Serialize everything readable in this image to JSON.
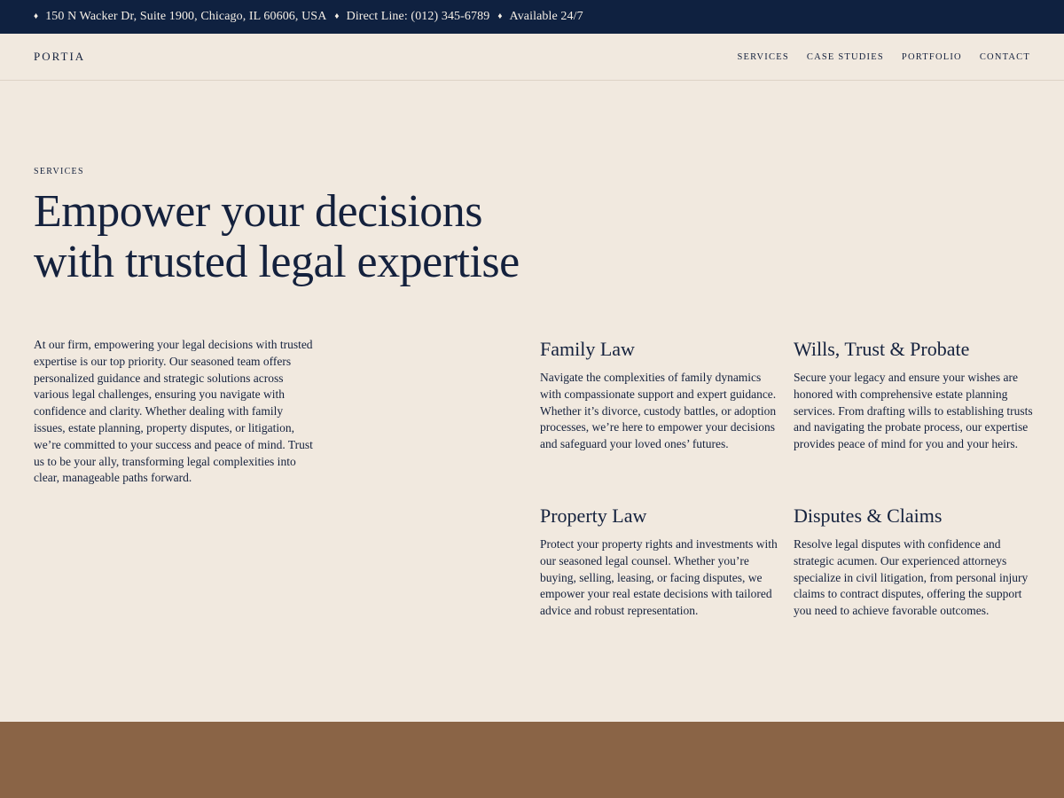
{
  "topbar": {
    "address": "150 N Wacker Dr, Suite 1900, Chicago, IL 60606, USA",
    "phone": "Direct Line: (012) 345-6789",
    "availability": "Available 24/7",
    "separator_icon": "diamond-icon"
  },
  "header": {
    "logo": "PORTIA",
    "nav": [
      "SERVICES",
      "CASE STUDIES",
      "PORTFOLIO",
      "CONTACT"
    ]
  },
  "hero": {
    "eyebrow": "SERVICES",
    "title_line1": "Empower your decisions",
    "title_line2": "with trusted legal expertise"
  },
  "intro": "At our firm, empowering your legal decisions with trusted expertise is our top priority. Our seasoned team offers personalized guidance and strategic solutions across various legal challenges, ensuring you navigate with confidence and clarity. Whether dealing with family issues, estate planning, property disputes, or litigation, we’re committed to your success and peace of mind. Trust us to be your ally, transforming legal complexities into clear, manageable paths forward.",
  "services": [
    {
      "title": "Family Law",
      "text": "Navigate the complexities of family dynamics with compassionate support and expert guidance. Whether it’s divorce, custody battles, or adoption processes, we’re here to empower your decisions and safeguard your loved ones’ futures."
    },
    {
      "title": "Wills, Trust & Probate",
      "text": "Secure your legacy and ensure your wishes are honored with comprehensive estate planning services. From drafting wills to establishing trusts and navigating the probate process, our expertise provides peace of mind for you and your heirs."
    },
    {
      "title": "Property Law",
      "text": "Protect your property rights and investments with our seasoned legal counsel. Whether you’re buying, selling, leasing, or facing disputes, we empower your real estate decisions with tailored advice and robust representation."
    },
    {
      "title": "Disputes & Claims",
      "text": "Resolve legal disputes with confidence and strategic acumen. Our experienced attorneys specialize in civil litigation, from personal injury claims to contract disputes, offering the support you need to achieve favorable outcomes."
    }
  ],
  "colors": {
    "topbar_bg": "#0f2140",
    "page_bg": "#f1e9df",
    "text": "#14213d",
    "footer_band": "#8a6446"
  }
}
